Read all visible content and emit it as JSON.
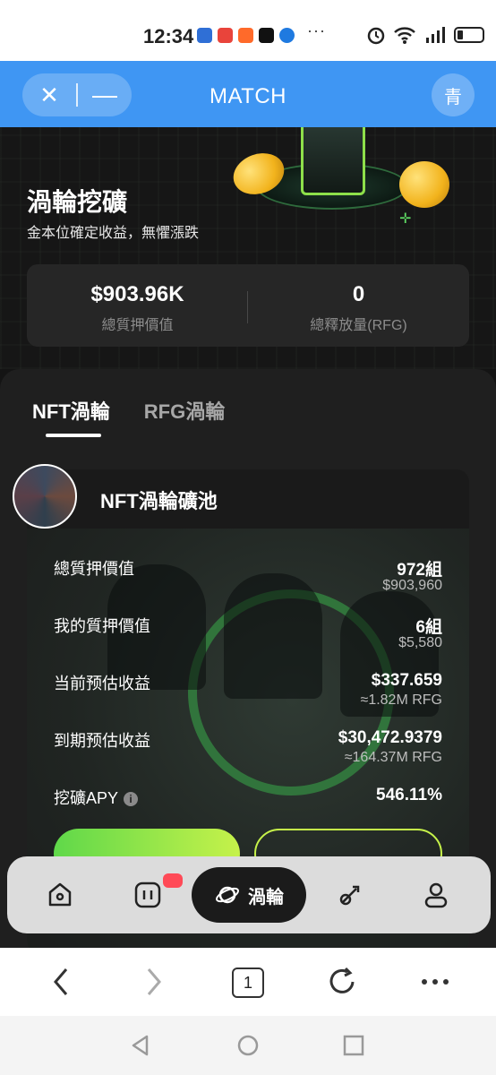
{
  "status_bar": {
    "time": "12:34"
  },
  "app_bar": {
    "title": "MATCH",
    "close_label": "✕",
    "minimize_label": "—",
    "avatar_text": "青"
  },
  "hero": {
    "title": "渦輪挖礦",
    "subtitle": "金本位確定收益，無懼漲跌",
    "stats": [
      {
        "value": "$903.96K",
        "label": "總質押價值"
      },
      {
        "value": "0",
        "label": "總釋放量(RFG)"
      }
    ]
  },
  "tabs": [
    {
      "label": "NFT渦輪",
      "active": true
    },
    {
      "label": "RFG渦輪",
      "active": false
    }
  ],
  "pool": {
    "name": "NFT渦輪礦池",
    "rows": [
      {
        "key": "總質押價值",
        "value": "972組",
        "sub": "$903,960"
      },
      {
        "key": "我的質押價值",
        "value": "6組",
        "sub": "$5,580"
      },
      {
        "key": "当前预估收益",
        "value": "$337.659",
        "sub": "≈1.82M RFG"
      },
      {
        "key": "到期预估收益",
        "value": "$30,472.9379",
        "sub": "≈164.37M RFG"
      },
      {
        "key": "挖礦APY",
        "value": "546.11%",
        "sub": ""
      }
    ]
  },
  "bottom_nav": {
    "items": [
      "home-icon",
      "chart-icon",
      "planet-icon",
      "rocket-icon",
      "user-icon"
    ],
    "active_label": "渦輪"
  },
  "browser_bar": {
    "tab_count": "1"
  },
  "colors": {
    "accent_green": "#5fd84a",
    "accent_lime": "#c6f24a",
    "header_blue": "#3f96f3"
  }
}
